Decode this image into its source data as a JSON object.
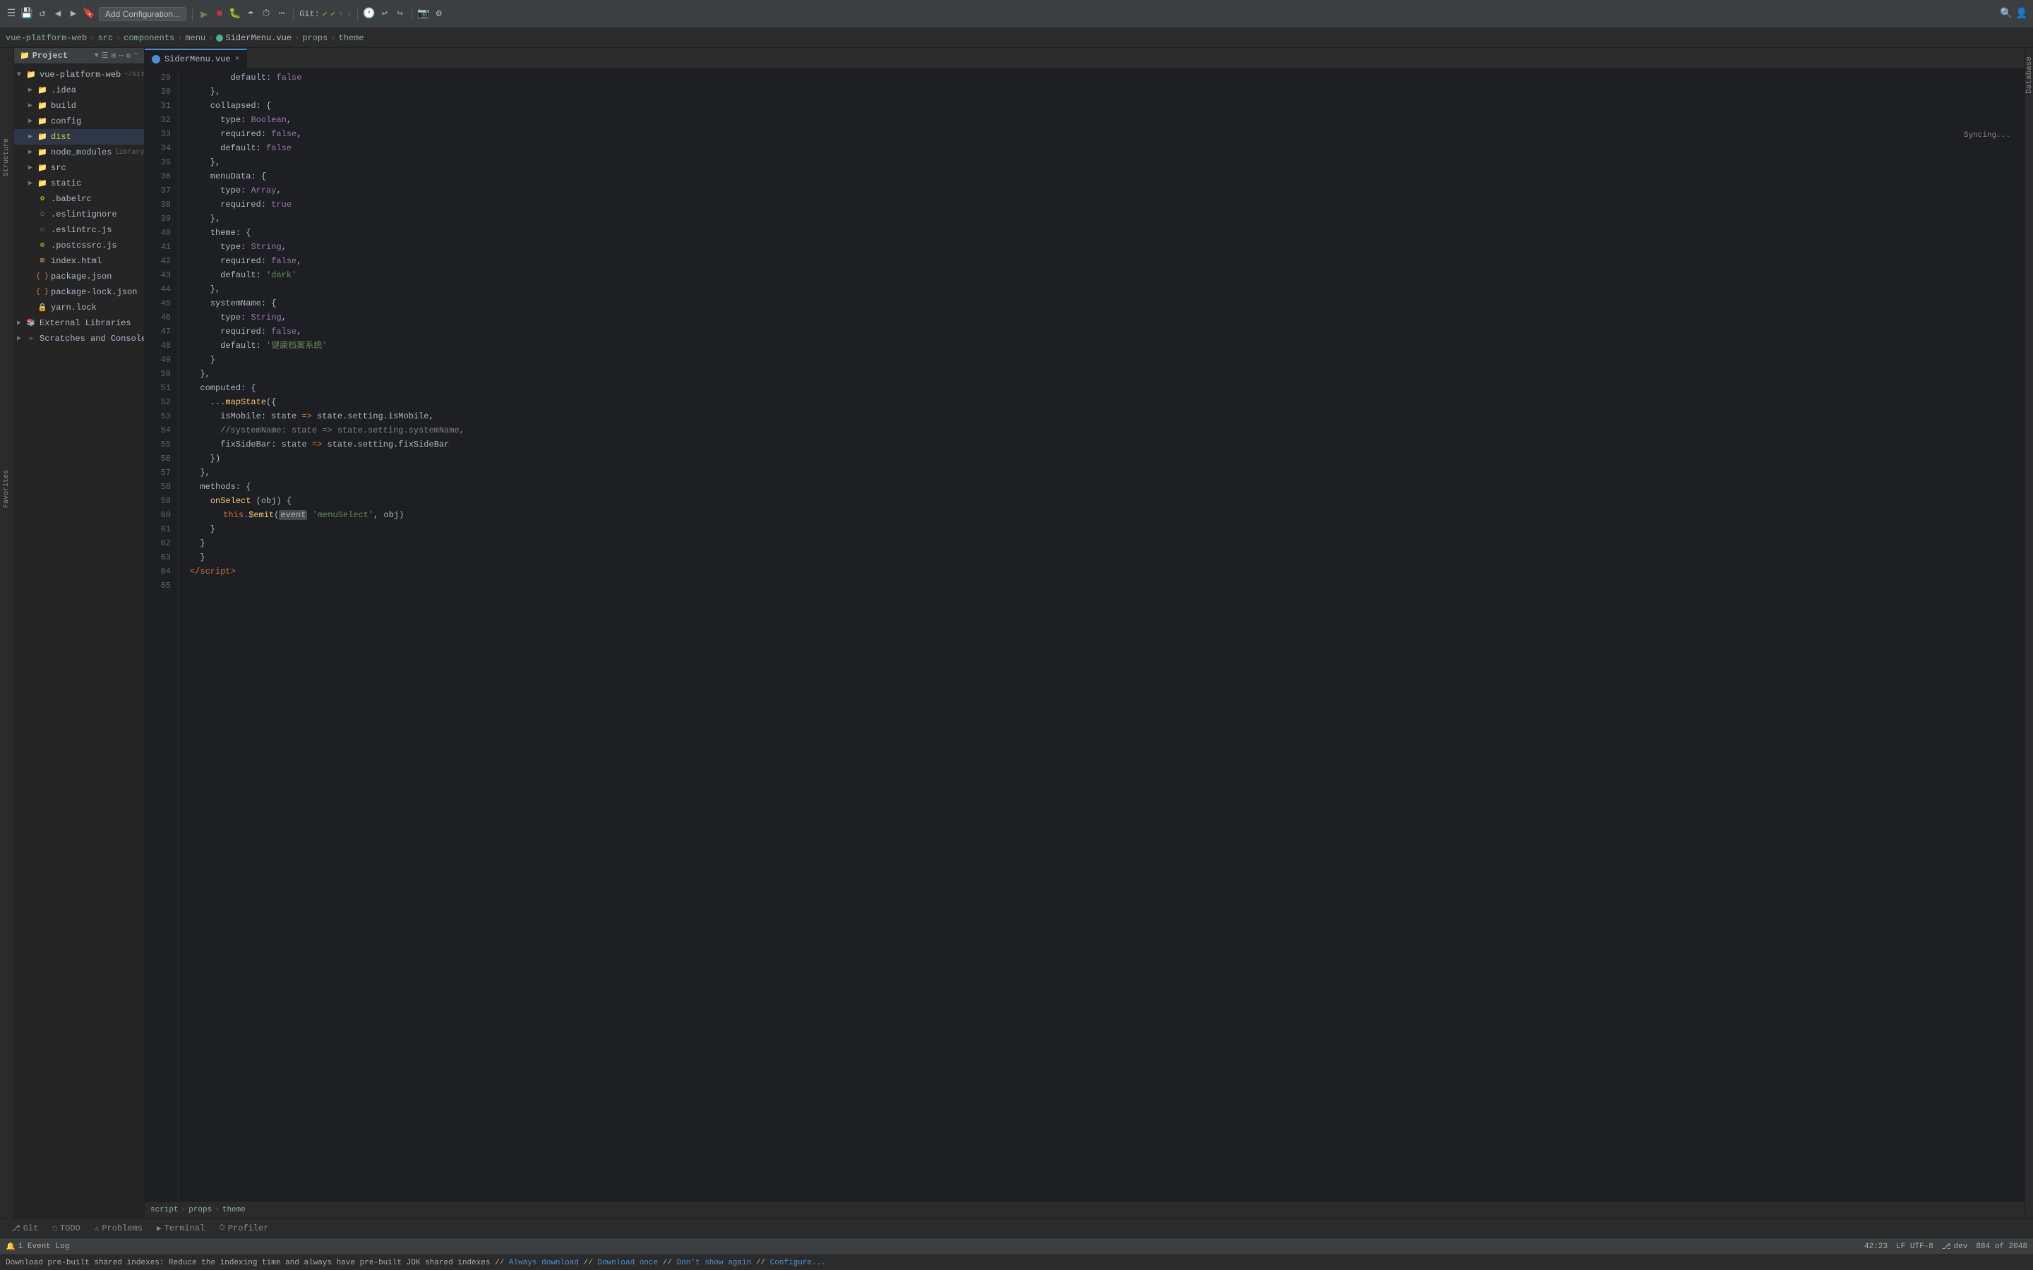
{
  "toolbar": {
    "add_config_label": "Add Configuration...",
    "git_label": "Git:",
    "run_icon": "▶",
    "stop_icon": "■",
    "debug_icon": "🐞",
    "build_icon": "🔨"
  },
  "breadcrumb": {
    "parts": [
      "vue-platform-web",
      "src",
      "components",
      "menu",
      "SiderMenu.vue",
      "props",
      "theme"
    ]
  },
  "sidebar": {
    "title": "Project",
    "root": {
      "name": "vue-platform-web",
      "git_path": "~/GitCode/health-platform/vu"
    },
    "items": [
      {
        "id": "idea",
        "label": ".idea",
        "indent": 1,
        "type": "folder",
        "collapsed": true
      },
      {
        "id": "build",
        "label": "build",
        "indent": 1,
        "type": "folder",
        "collapsed": true
      },
      {
        "id": "config",
        "label": "config",
        "indent": 1,
        "type": "folder",
        "collapsed": true
      },
      {
        "id": "dist",
        "label": "dist",
        "indent": 1,
        "type": "folder",
        "collapsed": true,
        "highlight": true
      },
      {
        "id": "node_modules",
        "label": "node_modules",
        "indent": 1,
        "type": "folder",
        "collapsed": true,
        "suffix": "library root"
      },
      {
        "id": "src",
        "label": "src",
        "indent": 1,
        "type": "folder",
        "collapsed": true
      },
      {
        "id": "static",
        "label": "static",
        "indent": 1,
        "type": "folder",
        "collapsed": true
      },
      {
        "id": "babelrc",
        "label": ".babelrc",
        "indent": 1,
        "type": "config"
      },
      {
        "id": "eslintignore",
        "label": ".eslintignore",
        "indent": 1,
        "type": "eslint"
      },
      {
        "id": "eslintrc",
        "label": ".eslintrc.js",
        "indent": 1,
        "type": "eslint"
      },
      {
        "id": "postcssrc",
        "label": ".postcssrc.js",
        "indent": 1,
        "type": "config"
      },
      {
        "id": "indexhtml",
        "label": "index.html",
        "indent": 1,
        "type": "html"
      },
      {
        "id": "packagejson",
        "label": "package.json",
        "indent": 1,
        "type": "json"
      },
      {
        "id": "packagelock",
        "label": "package-lock.json",
        "indent": 1,
        "type": "json"
      },
      {
        "id": "yarnlock",
        "label": "yarn.lock",
        "indent": 1,
        "type": "file"
      },
      {
        "id": "external",
        "label": "External Libraries",
        "indent": 0,
        "type": "folder",
        "collapsed": true
      },
      {
        "id": "scratches",
        "label": "Scratches and Consoles",
        "indent": 0,
        "type": "folder",
        "collapsed": true
      }
    ]
  },
  "editor": {
    "filename": "SiderMenu.vue",
    "lines": [
      {
        "num": 29,
        "tokens": [
          {
            "t": "        "
          },
          {
            "t": "default",
            "c": "plain"
          },
          {
            "t": ": ",
            "c": "plain"
          },
          {
            "t": "false",
            "c": "bool-val"
          }
        ]
      },
      {
        "num": 30,
        "tokens": [
          {
            "t": "    },",
            "c": "plain"
          }
        ]
      },
      {
        "num": 31,
        "tokens": [
          {
            "t": "    "
          },
          {
            "t": "collapsed",
            "c": "plain"
          },
          {
            "t": ": {",
            "c": "plain"
          }
        ]
      },
      {
        "num": 32,
        "tokens": [
          {
            "t": "      "
          },
          {
            "t": "type",
            "c": "plain"
          },
          {
            "t": ": ",
            "c": "plain"
          },
          {
            "t": "Boolean",
            "c": "type2"
          },
          {
            "t": ",",
            "c": "plain"
          }
        ]
      },
      {
        "num": 33,
        "tokens": [
          {
            "t": "      "
          },
          {
            "t": "required",
            "c": "plain"
          },
          {
            "t": ": ",
            "c": "plain"
          },
          {
            "t": "false",
            "c": "bool-val"
          },
          {
            "t": ",",
            "c": "plain"
          }
        ]
      },
      {
        "num": 34,
        "tokens": [
          {
            "t": "      "
          },
          {
            "t": "default",
            "c": "plain"
          },
          {
            "t": ": ",
            "c": "plain"
          },
          {
            "t": "false",
            "c": "bool-val"
          }
        ]
      },
      {
        "num": 35,
        "tokens": [
          {
            "t": "    },",
            "c": "plain"
          }
        ]
      },
      {
        "num": 36,
        "tokens": [
          {
            "t": "    "
          },
          {
            "t": "menuData",
            "c": "plain"
          },
          {
            "t": ": {",
            "c": "plain"
          }
        ]
      },
      {
        "num": 37,
        "tokens": [
          {
            "t": "      "
          },
          {
            "t": "type",
            "c": "plain"
          },
          {
            "t": ": ",
            "c": "plain"
          },
          {
            "t": "Array",
            "c": "type2"
          },
          {
            "t": ",",
            "c": "plain"
          }
        ]
      },
      {
        "num": 38,
        "tokens": [
          {
            "t": "      "
          },
          {
            "t": "required",
            "c": "plain"
          },
          {
            "t": ": ",
            "c": "plain"
          },
          {
            "t": "true",
            "c": "bool-val"
          }
        ]
      },
      {
        "num": 39,
        "tokens": [
          {
            "t": "    },",
            "c": "plain"
          }
        ]
      },
      {
        "num": 40,
        "tokens": [
          {
            "t": "    "
          },
          {
            "t": "theme",
            "c": "plain"
          },
          {
            "t": ": {",
            "c": "plain"
          }
        ]
      },
      {
        "num": 41,
        "tokens": [
          {
            "t": "      "
          },
          {
            "t": "type",
            "c": "plain"
          },
          {
            "t": ": ",
            "c": "plain"
          },
          {
            "t": "String",
            "c": "type2"
          },
          {
            "t": ",",
            "c": "plain"
          }
        ]
      },
      {
        "num": 42,
        "tokens": [
          {
            "t": "      "
          },
          {
            "t": "required",
            "c": "plain"
          },
          {
            "t": ": ",
            "c": "plain"
          },
          {
            "t": "false",
            "c": "bool-val"
          },
          {
            "t": ",",
            "c": "plain"
          }
        ]
      },
      {
        "num": 43,
        "tokens": [
          {
            "t": "      "
          },
          {
            "t": "default",
            "c": "plain"
          },
          {
            "t": ": ",
            "c": "plain"
          },
          {
            "t": "'dark'",
            "c": "str"
          }
        ]
      },
      {
        "num": 44,
        "tokens": [
          {
            "t": "    },",
            "c": "plain"
          }
        ]
      },
      {
        "num": 45,
        "tokens": [
          {
            "t": "    "
          },
          {
            "t": "systemName",
            "c": "plain"
          },
          {
            "t": ": {",
            "c": "plain"
          }
        ]
      },
      {
        "num": 46,
        "tokens": [
          {
            "t": "      "
          },
          {
            "t": "type",
            "c": "plain"
          },
          {
            "t": ": ",
            "c": "plain"
          },
          {
            "t": "String",
            "c": "type2"
          },
          {
            "t": ",",
            "c": "plain"
          }
        ]
      },
      {
        "num": 47,
        "tokens": [
          {
            "t": "      "
          },
          {
            "t": "required",
            "c": "plain"
          },
          {
            "t": ": ",
            "c": "plain"
          },
          {
            "t": "false",
            "c": "bool-val"
          },
          {
            "t": ",",
            "c": "plain"
          }
        ]
      },
      {
        "num": 48,
        "tokens": [
          {
            "t": "      "
          },
          {
            "t": "default",
            "c": "plain"
          },
          {
            "t": ": ",
            "c": "plain"
          },
          {
            "t": "'健康档案系统'",
            "c": "str"
          }
        ]
      },
      {
        "num": 49,
        "tokens": [
          {
            "t": "    }",
            "c": "plain"
          }
        ]
      },
      {
        "num": 50,
        "tokens": [
          {
            "t": "  },",
            "c": "plain"
          }
        ]
      },
      {
        "num": 51,
        "tokens": [
          {
            "t": "  "
          },
          {
            "t": "computed",
            "c": "plain"
          },
          {
            "t": ": {",
            "c": "plain"
          }
        ]
      },
      {
        "num": 52,
        "tokens": [
          {
            "t": "    "
          },
          {
            "t": "...mapState",
            "c": "fn"
          },
          {
            "t": "({",
            "c": "plain"
          }
        ]
      },
      {
        "num": 53,
        "tokens": [
          {
            "t": "      "
          },
          {
            "t": "isMobile",
            "c": "plain"
          },
          {
            "t": ": ",
            "c": "plain"
          },
          {
            "t": "state",
            "c": "plain"
          },
          {
            "t": " => ",
            "c": "arrow"
          },
          {
            "t": "state",
            "c": "plain"
          },
          {
            "t": ".setting.",
            "c": "plain"
          },
          {
            "t": "isMobile",
            "c": "plain"
          },
          {
            "t": ",",
            "c": "plain"
          }
        ]
      },
      {
        "num": 54,
        "tokens": [
          {
            "t": "      "
          },
          {
            "t": "//systemName: state => state.setting.systemName,",
            "c": "comment"
          }
        ]
      },
      {
        "num": 55,
        "tokens": [
          {
            "t": "      "
          },
          {
            "t": "fixSideBar",
            "c": "plain"
          },
          {
            "t": ": ",
            "c": "plain"
          },
          {
            "t": "state",
            "c": "plain"
          },
          {
            "t": " => ",
            "c": "arrow"
          },
          {
            "t": "state",
            "c": "plain"
          },
          {
            "t": ".setting.",
            "c": "plain"
          },
          {
            "t": "fixSideBar",
            "c": "plain"
          }
        ]
      },
      {
        "num": 56,
        "tokens": [
          {
            "t": "    })",
            "c": "plain"
          }
        ]
      },
      {
        "num": 57,
        "tokens": [
          {
            "t": "  },",
            "c": "plain"
          }
        ]
      },
      {
        "num": 58,
        "tokens": [
          {
            "t": "  "
          },
          {
            "t": "methods",
            "c": "plain"
          },
          {
            "t": ": {",
            "c": "plain"
          }
        ]
      },
      {
        "num": 59,
        "tokens": [
          {
            "t": "    "
          },
          {
            "t": "onSelect",
            "c": "fn"
          },
          {
            "t": " (",
            "c": "plain"
          },
          {
            "t": "obj",
            "c": "plain"
          },
          {
            "t": ") {",
            "c": "plain"
          }
        ]
      },
      {
        "num": 60,
        "tokens": [
          {
            "t": "      "
          },
          {
            "t": "this",
            "c": "kw"
          },
          {
            "t": ".",
            "c": "plain"
          },
          {
            "t": "$emit",
            "c": "fn"
          },
          {
            "t": "(",
            "c": "plain"
          },
          {
            "t": "event",
            "c": "plain",
            "highlight": true
          },
          {
            "t": " ",
            "c": "plain"
          },
          {
            "t": "'menuSelect'",
            "c": "str"
          },
          {
            "t": ", obj)",
            "c": "plain"
          }
        ]
      },
      {
        "num": 61,
        "tokens": [
          {
            "t": "    }",
            "c": "plain"
          }
        ]
      },
      {
        "num": 62,
        "tokens": [
          {
            "t": "  }",
            "c": "plain"
          }
        ]
      },
      {
        "num": 63,
        "tokens": [
          {
            "t": "  }",
            "c": "plain"
          }
        ]
      },
      {
        "num": 64,
        "tokens": [
          {
            "t": "</",
            "c": "kw"
          },
          {
            "t": "script",
            "c": "plain"
          },
          {
            "t": ">",
            "c": "kw"
          }
        ]
      },
      {
        "num": 65,
        "tokens": [
          {
            "t": "",
            "c": "plain"
          }
        ]
      }
    ]
  },
  "editor_breadcrumb": {
    "parts": [
      "script",
      "props",
      "theme"
    ]
  },
  "status_bar": {
    "git": "Git",
    "todo": "TODO",
    "problems": "Problems",
    "terminal": "Terminal",
    "profiler": "Profiler",
    "line_col": "42:23",
    "encoding": "LF  UTF-8",
    "branch": "dev",
    "col_info": "884 of 2048",
    "event_log": "1 Event Log",
    "syncing": "Syncing..."
  },
  "message_bar": {
    "text": "Download pre-built shared indexes: Reduce the indexing time and always have pre-built JDK shared indexes // Always download // Download once // Don't show again // Configure..."
  },
  "right_panel": {
    "label": "Database"
  },
  "left_vtabs": {
    "structure": "Structure",
    "favorites": "Favorites"
  }
}
